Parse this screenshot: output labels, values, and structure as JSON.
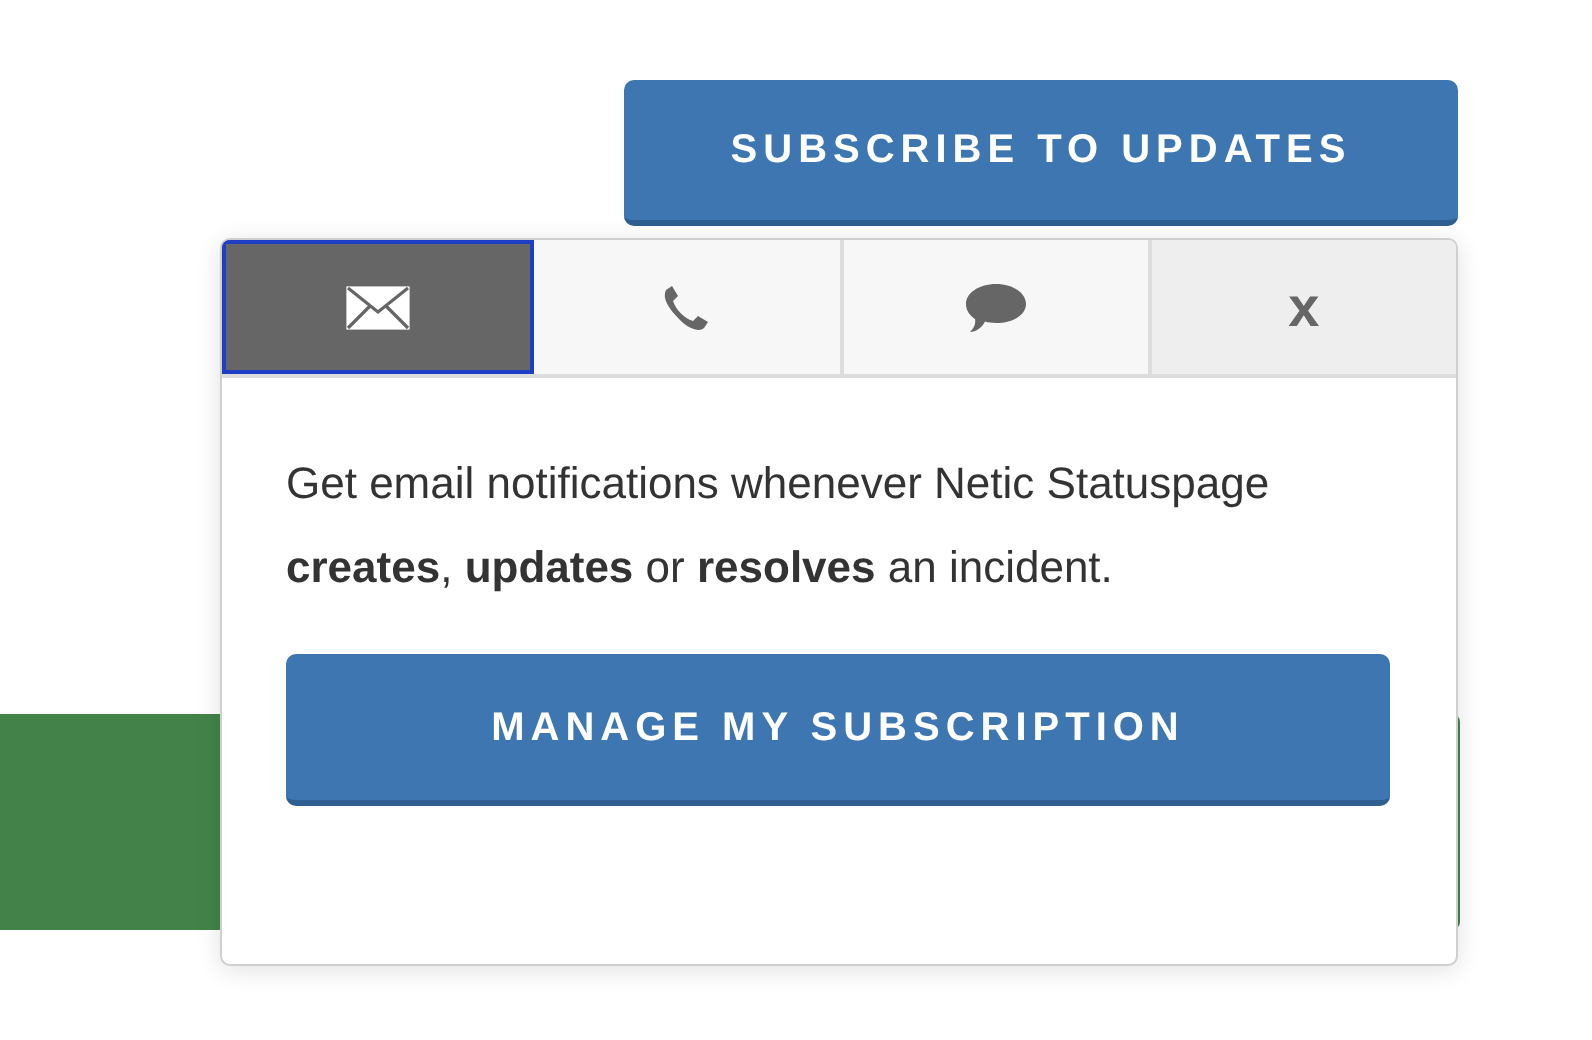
{
  "subscribe_button": {
    "label": "SUBSCRIBE TO UPDATES"
  },
  "popup": {
    "tabs": [
      {
        "kind": "email",
        "selected": true
      },
      {
        "kind": "phone",
        "selected": false
      },
      {
        "kind": "chat",
        "selected": false
      },
      {
        "kind": "close",
        "label": "x",
        "selected": false
      }
    ],
    "description": "Get email notifications whenever Netic Statuspage **creates**, **updates** or **resolves** an incident.",
    "action_button": {
      "label": "MANAGE MY SUBSCRIPTION"
    }
  }
}
